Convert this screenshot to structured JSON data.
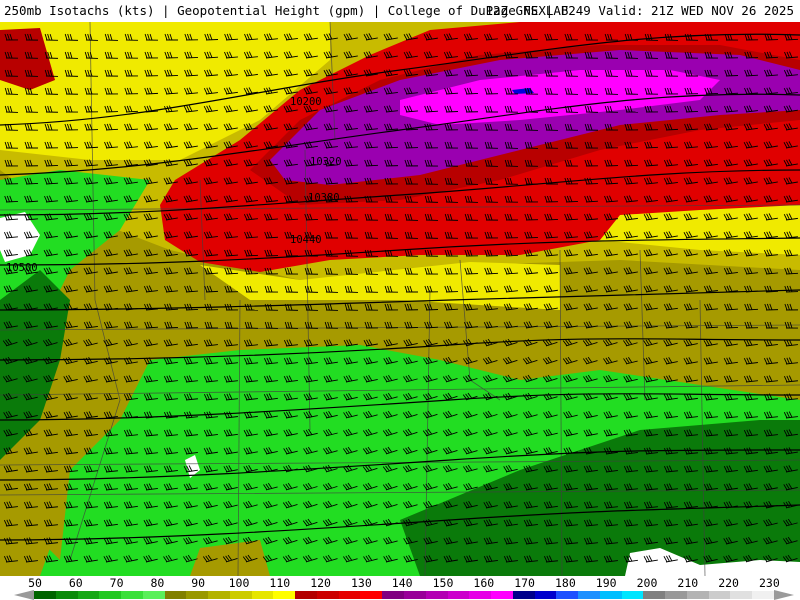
{
  "header": {
    "left_text": "250mb Isotachs (kts) | Geopotential Height (gpm) | College of DuPage NEXLAB",
    "right_text": "12Z GFS | F249 Valid: 21Z WED NOV 26 2025"
  },
  "contour_labels": [
    "10200",
    "10320",
    "10380",
    "10440",
    "10500"
  ],
  "colorbar": {
    "tick_labels": [
      "50",
      "60",
      "70",
      "80",
      "90",
      "100",
      "110",
      "120",
      "130",
      "140",
      "150",
      "160",
      "170",
      "180",
      "190",
      "200",
      "210",
      "220",
      "230"
    ],
    "colors": [
      "#006400",
      "#0a8a0a",
      "#15a815",
      "#22c822",
      "#3ae03a",
      "#5af05a",
      "#808000",
      "#999900",
      "#b3b300",
      "#cccc00",
      "#e6e600",
      "#ffff00",
      "#b30000",
      "#cc0000",
      "#e60000",
      "#ff0000",
      "#800080",
      "#990099",
      "#b300b3",
      "#cc00cc",
      "#e600e6",
      "#ff00ff",
      "#00008b",
      "#0000cd",
      "#1e50ff",
      "#1e90ff",
      "#00bfff",
      "#00e5ff",
      "#808080",
      "#999999",
      "#b3b3b3",
      "#cccccc",
      "#e0e0e0",
      "#f0f0f0"
    ]
  },
  "colors": {
    "green_dark": "#0a7a0a",
    "green": "#22dd22",
    "olive": "#a69a00",
    "yellow_olive": "#c8bb00",
    "yellow": "#f0ea00",
    "red": "#e00000",
    "dark_red": "#b80000",
    "purple": "#9a00b0",
    "magenta": "#ff00ff",
    "blue_core": "#0000dd"
  }
}
